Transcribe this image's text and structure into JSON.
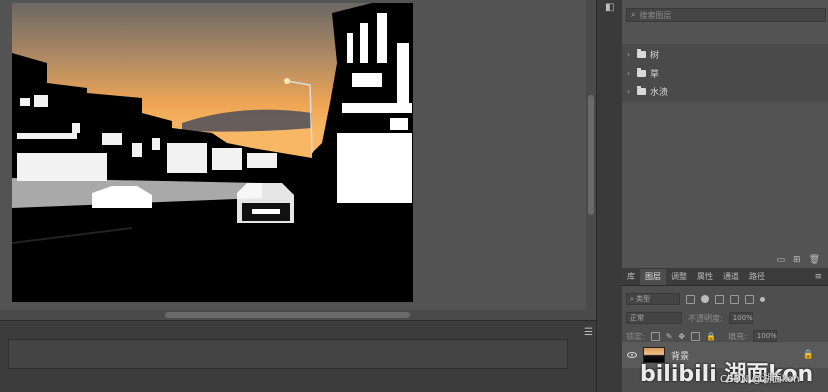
{
  "colors": {
    "panel_bg": "#535353",
    "panel_dark": "#3c3c3c",
    "sky_top": "#6e6e6e",
    "sky_sunset": "#f3a552"
  },
  "search": {
    "placeholder": "搜索图层"
  },
  "groups": [
    {
      "name": "树",
      "icon": "folder-icon"
    },
    {
      "name": "草",
      "icon": "folder-icon"
    },
    {
      "name": "水渍",
      "icon": "folder-icon"
    }
  ],
  "tabs": [
    {
      "label": "库",
      "active": false
    },
    {
      "label": "图层",
      "active": true
    },
    {
      "label": "调整",
      "active": false
    },
    {
      "label": "属性",
      "active": false
    },
    {
      "label": "通道",
      "active": false
    },
    {
      "label": "路径",
      "active": false
    }
  ],
  "layers_panel": {
    "filter_label": "类型",
    "blend_mode": "正常",
    "opacity_label": "不透明度:",
    "opacity_value": "100%",
    "lock_label": "锁定:",
    "fill_label": "填充:",
    "fill_value": "100%"
  },
  "layer": {
    "name": "背景"
  },
  "watermark": {
    "text": "bilibili 湖面kon",
    "sub": "CSDN @湖面kon"
  }
}
